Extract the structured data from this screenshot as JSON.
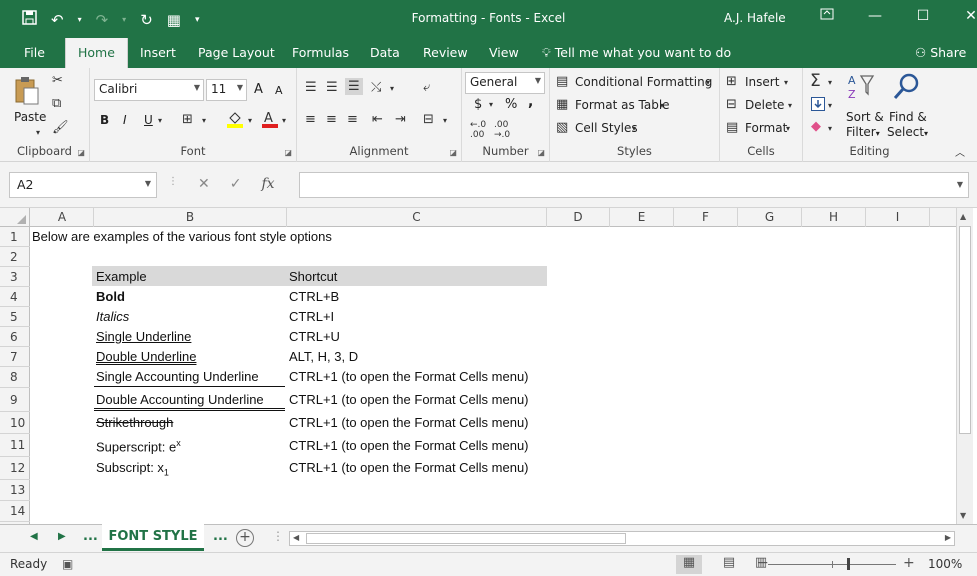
{
  "window": {
    "title": "Formatting - Fonts  -  Excel",
    "user": "A.J. Hafele",
    "qat_icons": [
      "save-icon",
      "undo-icon",
      "redo-icon",
      "refresh-icon",
      "grid-icon",
      "customize-icon"
    ]
  },
  "tabs": {
    "file": "File",
    "home": "Home",
    "insert": "Insert",
    "page_layout": "Page Layout",
    "formulas": "Formulas",
    "data": "Data",
    "review": "Review",
    "view": "View",
    "tell_me": "Tell me what you want to do",
    "share": "Share"
  },
  "ribbon": {
    "clipboard": {
      "label": "Clipboard",
      "paste": "Paste"
    },
    "font": {
      "label": "Font",
      "name": "Calibri",
      "size": "11",
      "bold": "B",
      "italic": "I",
      "underline": "U",
      "grow": "A",
      "shrink": "A"
    },
    "alignment": {
      "label": "Alignment"
    },
    "number": {
      "label": "Number",
      "format": "General",
      "currency": "$",
      "percent": "%",
      "comma": ","
    },
    "styles": {
      "label": "Styles",
      "conditional": "Conditional Formatting",
      "table": "Format as Table",
      "cell_styles": "Cell Styles"
    },
    "cells": {
      "label": "Cells",
      "insert": "Insert",
      "delete": "Delete",
      "format": "Format"
    },
    "editing": {
      "label": "Editing",
      "sort": "Sort &",
      "filter": "Filter",
      "find": "Find &",
      "select": "Select"
    }
  },
  "formula_bar": {
    "name_box": "A2",
    "formula": ""
  },
  "grid": {
    "columns": [
      "A",
      "B",
      "C",
      "D",
      "E",
      "F",
      "G",
      "H",
      "I"
    ],
    "rows": [
      "1",
      "2",
      "3",
      "4",
      "5",
      "6",
      "7",
      "8",
      "9",
      "10",
      "11",
      "12",
      "13",
      "14"
    ],
    "a1": "Below are examples of the various font style options",
    "header": {
      "example": "Example",
      "shortcut": "Shortcut"
    },
    "items": [
      {
        "example": "Bold",
        "shortcut": "CTRL+B"
      },
      {
        "example": "Italics",
        "shortcut": "CTRL+I"
      },
      {
        "example": "Single Underline",
        "shortcut": "CTRL+U"
      },
      {
        "example": "Double Underline",
        "shortcut": "ALT, H, 3, D"
      },
      {
        "example": "Single Accounting Underline",
        "shortcut": "CTRL+1 (to open the Format Cells menu)"
      },
      {
        "example": "Double Accounting Underline",
        "shortcut": "CTRL+1 (to open the Format Cells menu)"
      },
      {
        "example": "Strikethrough",
        "shortcut": "CTRL+1 (to open the Format Cells menu)"
      },
      {
        "example": "Superscript: e",
        "sup": "x",
        "shortcut": "CTRL+1 (to open the Format Cells menu)"
      },
      {
        "example": "Subscript: x",
        "sub": "1",
        "shortcut": "CTRL+1 (to open the Format Cells menu)"
      }
    ]
  },
  "sheets": {
    "more_left": "...",
    "active": "FONT STYLE",
    "more_right": "..."
  },
  "status": {
    "ready": "Ready",
    "zoom": "100%"
  },
  "colors": {
    "brand": "#217346",
    "ribbon_bg": "#f3f3f3",
    "header_band": "#d9d9d9"
  }
}
